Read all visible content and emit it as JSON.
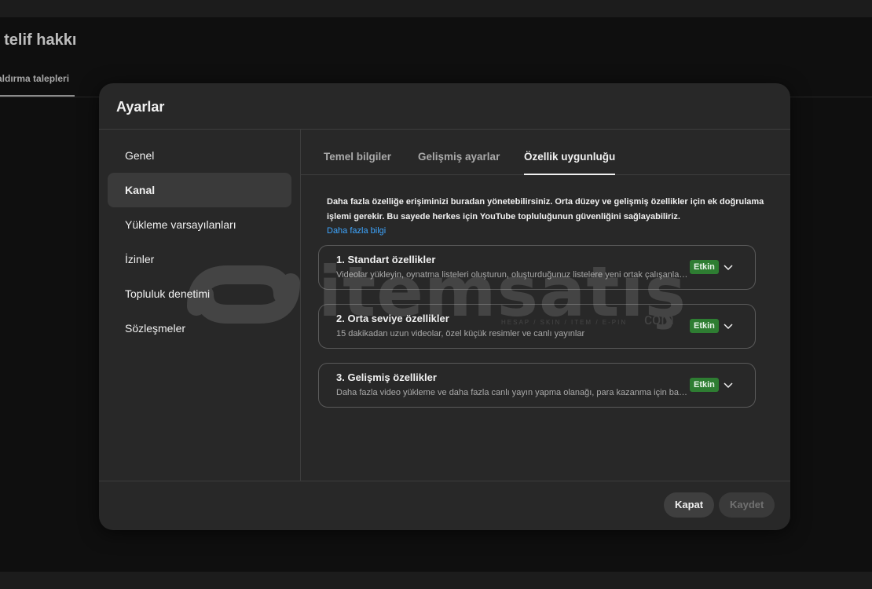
{
  "background": {
    "page_title": "l telif hakkı",
    "page_tab": "aldırma talepleri"
  },
  "dialog": {
    "title": "Ayarlar",
    "sidebar": [
      {
        "label": "Genel",
        "active": false
      },
      {
        "label": "Kanal",
        "active": true
      },
      {
        "label": "Yükleme varsayılanları",
        "active": false
      },
      {
        "label": "İzinler",
        "active": false
      },
      {
        "label": "Topluluk denetimi",
        "active": false
      },
      {
        "label": "Sözleşmeler",
        "active": false
      }
    ],
    "tabs": [
      {
        "label": "Temel bilgiler",
        "active": false
      },
      {
        "label": "Gelişmiş ayarlar",
        "active": false
      },
      {
        "label": "Özellik uygunluğu",
        "active": true
      }
    ],
    "intro": {
      "text": "Daha fazla özelliğe erişiminizi buradan yönetebilirsiniz. Orta düzey ve gelişmiş özellikler için ek doğrulama işlemi gerekir. Bu sayede herkes için YouTube topluluğunun güvenliğini sağlayabiliriz.",
      "link": "Daha fazla bilgi"
    },
    "features": [
      {
        "title": "1. Standart özellikler",
        "description": "Videolar yükleyin, oynatma listeleri oluşturun, oluşturduğunuz listelere yeni ortak çalışanlar ekleyin",
        "status": "Etkin"
      },
      {
        "title": "2. Orta seviye özellikler",
        "description": "15 dakikadan uzun videolar, özel küçük resimler ve canlı yayınlar",
        "status": "Etkin"
      },
      {
        "title": "3. Gelişmiş özellikler",
        "description": "Daha fazla video yükleme ve daha fazla canlı yayın yapma olanağı, para kazanma için başvuru",
        "status": "Etkin"
      }
    ],
    "buttons": {
      "close": "Kapat",
      "save": "Kaydet"
    }
  },
  "watermark": {
    "text": "itemsatış",
    "sub": "HESAP / SKIN / ITEM / E-PIN",
    "suffix": "com"
  },
  "colors": {
    "dialog_bg": "#282828",
    "page_bg": "#0f0f0f",
    "accent_link": "#3ea6ff",
    "badge_green": "#2e7d32"
  }
}
